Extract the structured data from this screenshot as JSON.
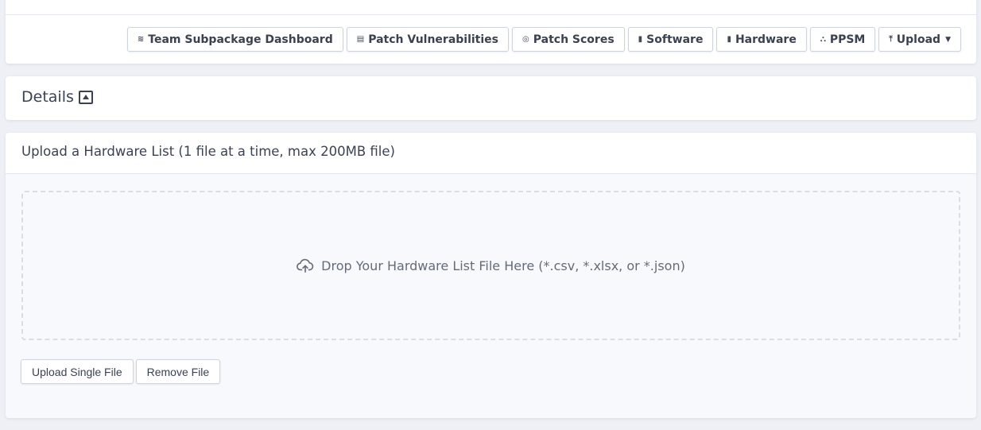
{
  "toolbar": {
    "buttons": [
      {
        "icon": "layers-icon",
        "glyph": "≋",
        "label": "Team Subpackage Dashboard"
      },
      {
        "icon": "server-icon",
        "glyph": "▤",
        "label": "Patch Vulnerabilities"
      },
      {
        "icon": "target-icon",
        "glyph": "◎",
        "label": "Patch Scores"
      },
      {
        "icon": "clipboard-icon",
        "glyph": "▮",
        "label": "Software"
      },
      {
        "icon": "clipboard-icon",
        "glyph": "▮",
        "label": "Hardware"
      },
      {
        "icon": "sitemap-icon",
        "glyph": "⛬",
        "label": "PPSM"
      },
      {
        "icon": "upload-icon",
        "glyph": "⤒",
        "label": "Upload"
      }
    ]
  },
  "details": {
    "title": "Details",
    "icon": "collapse-up-icon"
  },
  "upload": {
    "header": "Upload a Hardware List (1 file at a time, max 200MB file)",
    "dropzone_text": "Drop Your Hardware List File Here (*.csv, *.xlsx, or *.json)",
    "dropzone_icon": "cloud-upload-icon",
    "upload_button": "Upload Single File",
    "remove_button": "Remove File"
  }
}
